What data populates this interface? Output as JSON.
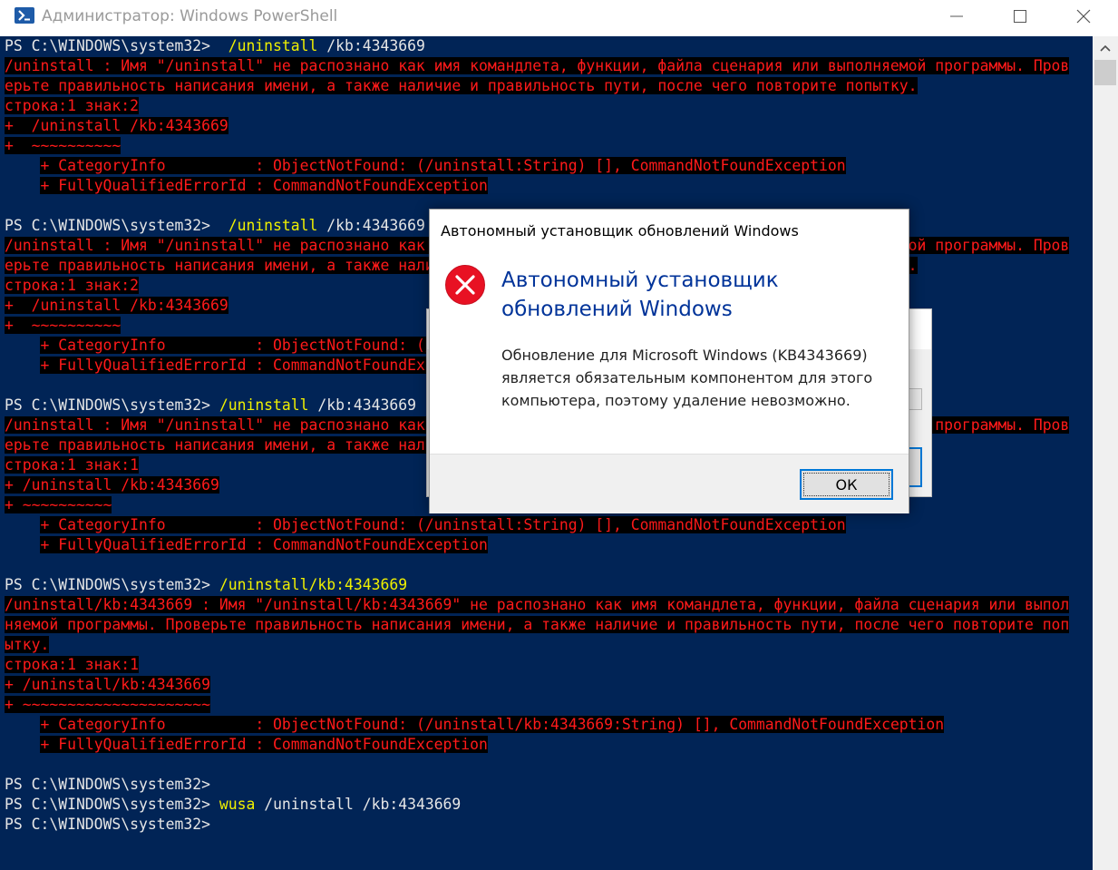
{
  "window": {
    "title": "Администратор: Windows PowerShell",
    "icon": "powershell-icon",
    "controls": [
      "minimize-icon",
      "maximize-icon",
      "close-icon"
    ]
  },
  "console": {
    "colors": {
      "background": "#012456",
      "text": "#e6e6e6",
      "command": "#f0f000",
      "error_text": "#ff1a1a",
      "error_bg": "#000000"
    },
    "lines": [
      [
        {
          "t": "PS C:\\WINDOWS\\system32>  ",
          "c": "ps"
        },
        {
          "t": "/uninstall",
          "c": "cmd"
        },
        {
          "t": " /kb:4343669",
          "c": "ps"
        }
      ],
      [
        {
          "t": "/uninstall : Имя \"/uninstall\" не распознано как имя командлета, функции, файла сценария или выполняемой программы. Пров",
          "c": "err"
        }
      ],
      [
        {
          "t": "ерьте правильность написания имени, а также наличие и правильность пути, после чего повторите попытку.",
          "c": "err"
        }
      ],
      [
        {
          "t": "строка:1 знак:2",
          "c": "err"
        }
      ],
      [
        {
          "t": "+  /uninstall /kb:4343669",
          "c": "err"
        }
      ],
      [
        {
          "t": "+  ~~~~~~~~~~",
          "c": "err"
        }
      ],
      [
        {
          "t": "    ",
          "c": "ps"
        },
        {
          "t": "+ CategoryInfo          : ObjectNotFound: (/uninstall:String) [], CommandNotFoundException",
          "c": "err"
        }
      ],
      [
        {
          "t": "    ",
          "c": "ps"
        },
        {
          "t": "+ FullyQualifiedErrorId : CommandNotFoundException",
          "c": "err"
        }
      ],
      [
        {
          "t": "",
          "c": "ps"
        }
      ],
      [
        {
          "t": "PS C:\\WINDOWS\\system32>  ",
          "c": "ps"
        },
        {
          "t": "/uninstall",
          "c": "cmd"
        },
        {
          "t": " /kb:4343669",
          "c": "ps"
        }
      ],
      [
        {
          "t": "/uninstall : Имя \"/uninstall\" не распознано как имя командлета, функции, файла сценария или выполняемой программы. Пров",
          "c": "err"
        }
      ],
      [
        {
          "t": "ерьте правильность написания имени, а также наличие и правильность пути, после чего повторите попытку.",
          "c": "err"
        }
      ],
      [
        {
          "t": "строка:1 знак:2",
          "c": "err"
        }
      ],
      [
        {
          "t": "+  /uninstall /kb:4343669",
          "c": "err"
        }
      ],
      [
        {
          "t": "+  ~~~~~~~~~~",
          "c": "err"
        }
      ],
      [
        {
          "t": "    ",
          "c": "ps"
        },
        {
          "t": "+ CategoryInfo          : ObjectNotFound: (/uninstall:String) [], CommandNotFoundException",
          "c": "err"
        }
      ],
      [
        {
          "t": "    ",
          "c": "ps"
        },
        {
          "t": "+ FullyQualifiedErrorId : CommandNotFoundException",
          "c": "err"
        }
      ],
      [
        {
          "t": "",
          "c": "ps"
        }
      ],
      [
        {
          "t": "PS C:\\WINDOWS\\system32> ",
          "c": "ps"
        },
        {
          "t": "/uninstall",
          "c": "cmd"
        },
        {
          "t": " /kb:4343669",
          "c": "ps"
        }
      ],
      [
        {
          "t": "/uninstall : Имя \"/uninstall\" не распознано как имя командлета, функции, файла сценария или выполняемой программы. Пров",
          "c": "err"
        }
      ],
      [
        {
          "t": "ерьте правильность написания имени, а также наличие и правильность пути, после чего повторите попытку.",
          "c": "err"
        }
      ],
      [
        {
          "t": "строка:1 знак:1",
          "c": "err"
        }
      ],
      [
        {
          "t": "+ /uninstall /kb:4343669",
          "c": "err"
        }
      ],
      [
        {
          "t": "+ ~~~~~~~~~~",
          "c": "err"
        }
      ],
      [
        {
          "t": "    ",
          "c": "ps"
        },
        {
          "t": "+ CategoryInfo          : ObjectNotFound: (/uninstall:String) [], CommandNotFoundException",
          "c": "err"
        }
      ],
      [
        {
          "t": "    ",
          "c": "ps"
        },
        {
          "t": "+ FullyQualifiedErrorId : CommandNotFoundException",
          "c": "err"
        }
      ],
      [
        {
          "t": "",
          "c": "ps"
        }
      ],
      [
        {
          "t": "PS C:\\WINDOWS\\system32> ",
          "c": "ps"
        },
        {
          "t": "/uninstall/kb:4343669",
          "c": "cmd"
        }
      ],
      [
        {
          "t": "/uninstall/kb:4343669 : Имя \"/uninstall/kb:4343669\" не распознано как имя командлета, функции, файла сценария или выпол",
          "c": "err"
        }
      ],
      [
        {
          "t": "няемой программы. Проверьте правильность написания имени, а также наличие и правильность пути, после чего повторите поп",
          "c": "err"
        }
      ],
      [
        {
          "t": "ытку.",
          "c": "err"
        }
      ],
      [
        {
          "t": "строка:1 знак:1",
          "c": "err"
        }
      ],
      [
        {
          "t": "+ /uninstall/kb:4343669",
          "c": "err"
        }
      ],
      [
        {
          "t": "+ ~~~~~~~~~~~~~~~~~~~~~",
          "c": "err"
        }
      ],
      [
        {
          "t": "    ",
          "c": "ps"
        },
        {
          "t": "+ CategoryInfo          : ObjectNotFound: (/uninstall/kb:4343669:String) [], CommandNotFoundException",
          "c": "err"
        }
      ],
      [
        {
          "t": "    ",
          "c": "ps"
        },
        {
          "t": "+ FullyQualifiedErrorId : CommandNotFoundException",
          "c": "err"
        }
      ],
      [
        {
          "t": "",
          "c": "ps"
        }
      ],
      [
        {
          "t": "PS C:\\WINDOWS\\system32>",
          "c": "ps"
        }
      ],
      [
        {
          "t": "PS C:\\WINDOWS\\system32> ",
          "c": "ps"
        },
        {
          "t": "wusa",
          "c": "cmd"
        },
        {
          "t": " /uninstall /kb:4343669",
          "c": "ps"
        }
      ],
      [
        {
          "t": "PS C:\\WINDOWS\\system32>",
          "c": "ps"
        }
      ]
    ]
  },
  "dialog": {
    "caption": "Автономный установщик обновлений Windows",
    "icon": "error-icon",
    "heading": "Автономный установщик обновлений Windows",
    "message": "Обновление для Microsoft Windows (KB4343669) является обязательным компонентом для этого компьютера, поэтому удаление невозможно.",
    "ok_label": "ОК"
  }
}
